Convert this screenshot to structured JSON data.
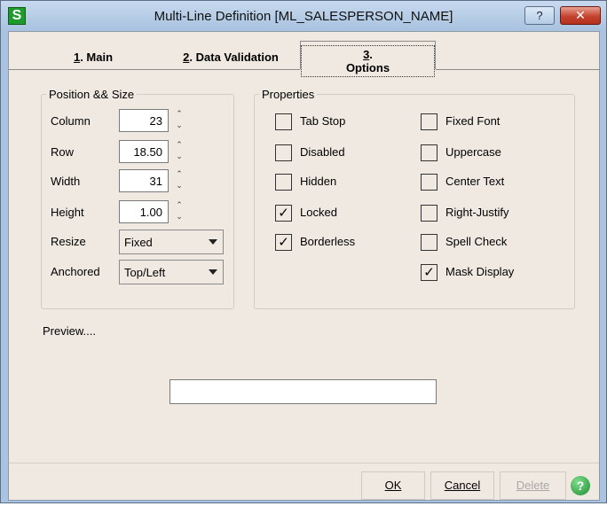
{
  "window": {
    "title": "Multi-Line Definition  [ML_SALESPERSON_NAME]",
    "app_icon": "S",
    "help_glyph": "?",
    "close_glyph": "✕"
  },
  "tabs": {
    "main": {
      "num": "1",
      "label": ". Main"
    },
    "data_validation": {
      "num": "2",
      "label": ". Data Validation"
    },
    "options": {
      "num": "3",
      "label": ". Options"
    }
  },
  "position_size": {
    "title": "Position && Size",
    "column": {
      "label": "Column",
      "value": "23"
    },
    "row": {
      "label": "Row",
      "value": "18.50"
    },
    "width": {
      "label": "Width",
      "value": "31"
    },
    "height": {
      "label": "Height",
      "value": "1.00"
    },
    "resize": {
      "label": "Resize",
      "value": "Fixed"
    },
    "anchored": {
      "label": "Anchored",
      "value": "Top/Left"
    }
  },
  "properties": {
    "title": "Properties",
    "items": [
      {
        "label": "Tab Stop",
        "checked": false
      },
      {
        "label": "Disabled",
        "checked": false
      },
      {
        "label": "Hidden",
        "checked": false
      },
      {
        "label": "Locked",
        "checked": true
      },
      {
        "label": "Borderless",
        "checked": true
      },
      {
        "label": "Fixed Font",
        "checked": false
      },
      {
        "label": "Uppercase",
        "checked": false
      },
      {
        "label": "Center Text",
        "checked": false
      },
      {
        "label": "Right-Justify",
        "checked": false
      },
      {
        "label": "Spell Check",
        "checked": false
      },
      {
        "label": "Mask Display",
        "checked": true
      }
    ]
  },
  "preview": {
    "label": "Preview...."
  },
  "buttons": {
    "ok": "OK",
    "cancel": "Cancel",
    "delete": "Delete",
    "help": "?"
  }
}
